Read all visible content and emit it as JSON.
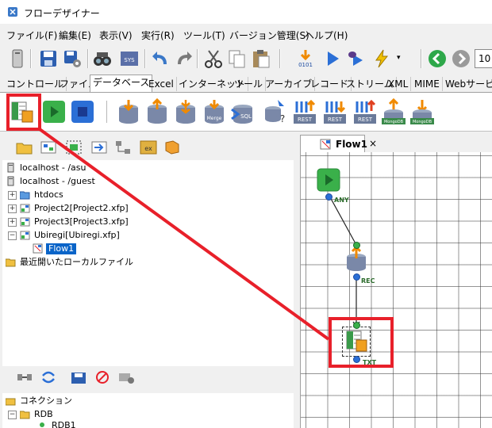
{
  "window": {
    "title": "フローデザイナー"
  },
  "menu": [
    "ファイル(F)",
    "編集(E)",
    "表示(V)",
    "実行(R)",
    "ツール(T)",
    "バージョン管理(S)",
    "ヘルプ(H)"
  ],
  "toolbar": {
    "zoom_value": "10"
  },
  "palette_tabs": [
    "コントロール",
    "ファイル",
    "データベース",
    "Excel",
    "インターネット",
    "ツール",
    "アーカイブ",
    "レコード",
    "ストリーム",
    "XML",
    "MIME",
    "Webサービス"
  ],
  "active_tab": "データベース",
  "palette_labels": {
    "merge": "Merge",
    "sql": "SQL",
    "rest": "REST",
    "mongodb": "MongoDB"
  },
  "tree": {
    "host_asu": "localhost - /asu",
    "host_guest": "localhost - /guest",
    "htdocs": "htdocs",
    "project2": "Project2[Project2.xfp]",
    "project3": "Project3[Project3.xfp]",
    "ubiregi": "Ubiregi[Ubiregi.xfp]",
    "flow1": "Flow1",
    "recent": "最近開いたローカルファイル"
  },
  "connections": {
    "root": "コネクション",
    "rdb": "RDB",
    "rdb1": "RDB1"
  },
  "flow": {
    "tab_label": "Flow1",
    "tab_close": "×",
    "port_any": "ANY",
    "port_rec": "REC",
    "port_txt": "TXT"
  },
  "colors": {
    "highlight": "#e8202a",
    "accent_blue": "#2b6fd6",
    "selection": "#0a64c8"
  }
}
